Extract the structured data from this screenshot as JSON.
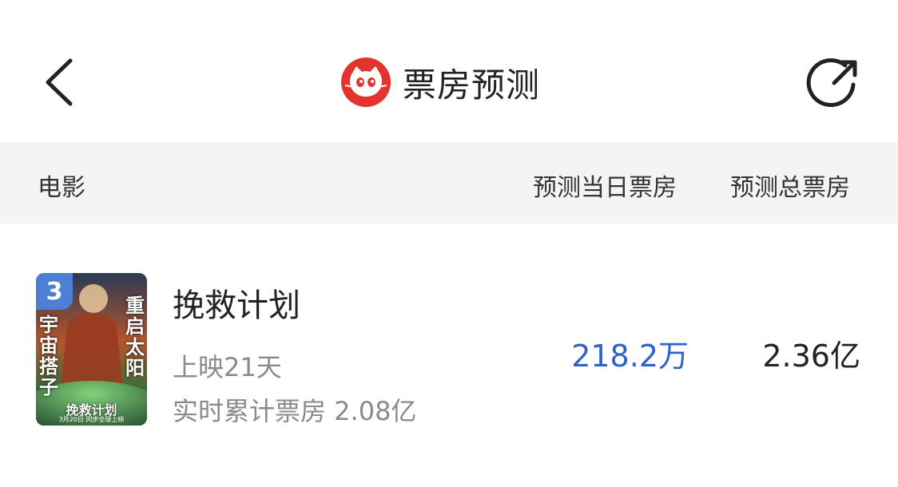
{
  "header": {
    "title": "票房预测",
    "back_icon": "chevron-left-icon",
    "share_icon": "share-icon",
    "logo_icon": "cat-logo-icon",
    "brand_color": "#e4322c"
  },
  "columns": {
    "movie": "电影",
    "daily": "预测当日票房",
    "total": "预测总票房"
  },
  "movies": [
    {
      "rank": "3",
      "name": "挽救计划",
      "days": "上映21天",
      "cumulative": "实时累计票房 2.08亿",
      "daily_forecast": "218.2万",
      "total_forecast": "2.36亿",
      "poster_text": {
        "left": "宇宙搭子",
        "right": "重启太阳",
        "bottom_title": "挽救计划",
        "bottom_date": "3月20日 同步全球上映"
      },
      "rank_color": "#4d7fd6",
      "daily_color": "#2d63c8"
    }
  ]
}
